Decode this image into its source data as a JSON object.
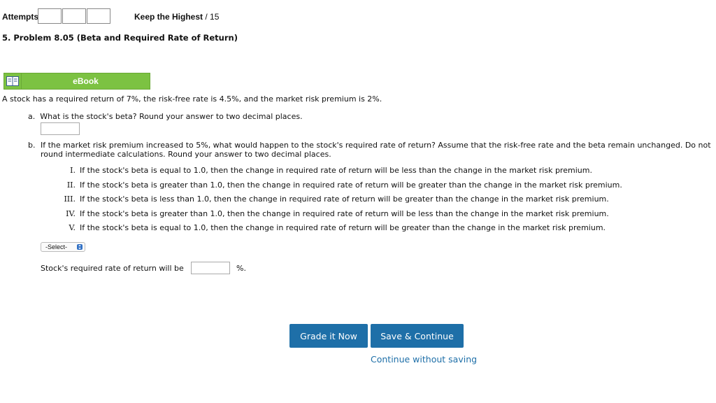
{
  "header": {
    "attempts_label": "Attempts",
    "attempt_count": 3,
    "keep_highest_label": "Keep the Highest",
    "score_total": "/ 15"
  },
  "problem": {
    "title": "5. Problem 8.05 (Beta and Required Rate of Return)",
    "ebook_label": "eBook",
    "intro": "A stock has a required return of 7%, the risk-free rate is 4.5%, and the market risk premium is 2%.",
    "part_a": {
      "label": "a.",
      "question": "What is the stock's beta? Round your answer to two decimal places.",
      "answer_value": ""
    },
    "part_b": {
      "label": "b.",
      "question": "If the market risk premium increased to 5%, what would happen to the stock's required rate of return? Assume that the risk-free rate and the beta remain unchanged. Do not round intermediate calculations. Round your answer to two decimal places.",
      "options": [
        {
          "num": "I.",
          "text": "If the stock's beta is equal to 1.0, then the change in required rate of return will be less than the change in the market risk premium."
        },
        {
          "num": "II.",
          "text": "If the stock's beta is greater than 1.0, then the change in required rate of return will be greater than the change in the market risk premium."
        },
        {
          "num": "III.",
          "text": "If the stock's beta is less than 1.0, then the change in required rate of return will be greater than the change in the market risk premium."
        },
        {
          "num": "IV.",
          "text": "If the stock's beta is greater than 1.0, then the change in required rate of return will be less than the change in the market risk premium."
        },
        {
          "num": "V.",
          "text": "If the stock's beta is equal to 1.0, then the change in required rate of return will be greater than the change in the market risk premium."
        }
      ],
      "select_value": "-Select-",
      "rate_label": "Stock's required rate of return will be",
      "rate_value": "",
      "rate_unit": "%."
    }
  },
  "actions": {
    "grade_label": "Grade it Now",
    "save_label": "Save & Continue",
    "continue_label": "Continue without saving"
  },
  "colors": {
    "ebook_green": "#7cc242",
    "button_blue": "#1e6fa8"
  }
}
